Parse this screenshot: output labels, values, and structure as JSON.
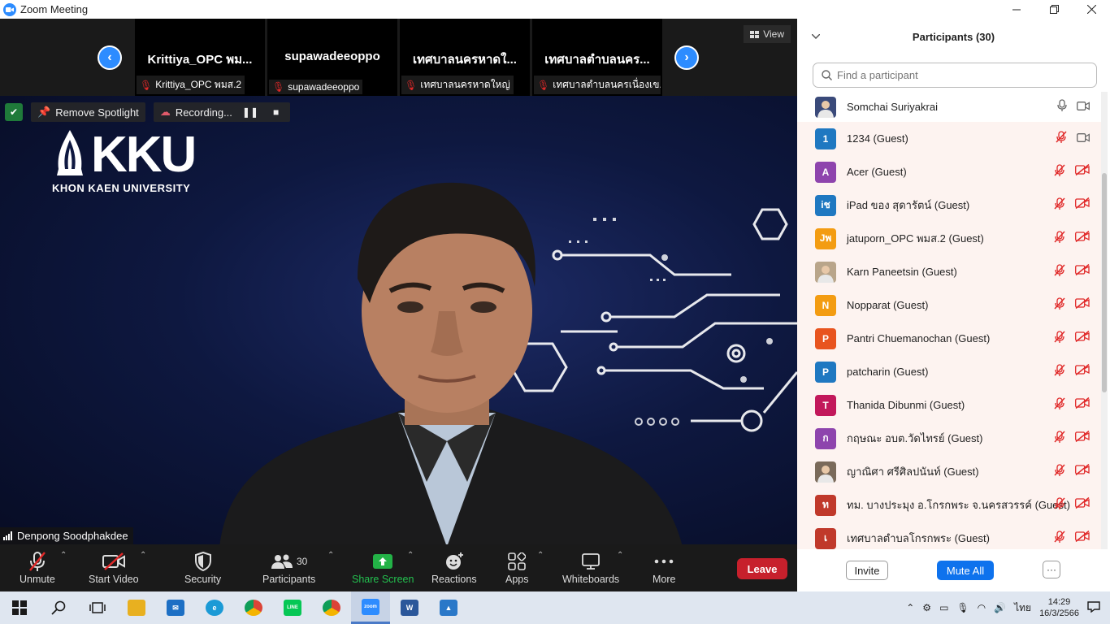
{
  "window": {
    "title": "Zoom Meeting",
    "logo_text": "zoom"
  },
  "strip": {
    "view_label": "View",
    "thumbs": [
      {
        "name": "Krittiya_OPC พม...",
        "label": "Krittiya_OPC พมส.2"
      },
      {
        "name": "supawadeeoppo",
        "label": "supawadeeoppo"
      },
      {
        "name": "เทศบาลนครหาดใ...",
        "label": "เทศบาลนครหาดใหญ่"
      },
      {
        "name": "เทศบาลตำบลนคร...",
        "label": "เทศบาลตำบลนครเนื่องเข..."
      }
    ]
  },
  "video": {
    "remove_spotlight": "Remove Spotlight",
    "recording": "Recording...",
    "logo_big": "KKU",
    "logo_small": "KHON KAEN UNIVERSITY",
    "speaker_name": "Denpong Soodphakdee"
  },
  "toolbar": {
    "unmute": "Unmute",
    "start_video": "Start Video",
    "security": "Security",
    "participants": "Participants",
    "participants_count": "30",
    "share_screen": "Share Screen",
    "reactions": "Reactions",
    "apps": "Apps",
    "whiteboards": "Whiteboards",
    "more": "More",
    "leave": "Leave"
  },
  "panel": {
    "title": "Participants (30)",
    "search_placeholder": "Find a participant",
    "invite": "Invite",
    "mute_all": "Mute All",
    "more": "···",
    "participants": [
      {
        "name": "Somchai Suriyakrai",
        "initial": "",
        "color": "#3a4a7a",
        "mic": "on",
        "video": "on"
      },
      {
        "name": "1234 (Guest)",
        "initial": "1",
        "color": "#1f78c1",
        "mic": "muted",
        "video": "on"
      },
      {
        "name": "Acer (Guest)",
        "initial": "A",
        "color": "#8e44ad",
        "mic": "muted",
        "video": "off"
      },
      {
        "name": "iPad ของ สุดารัตน์ (Guest)",
        "initial": "iช",
        "color": "#1f78c1",
        "mic": "muted",
        "video": "off"
      },
      {
        "name": "jatuporn_OPC พมส.2 (Guest)",
        "initial": "Jพ",
        "color": "#f39c12",
        "mic": "muted",
        "video": "off"
      },
      {
        "name": "Karn Paneetsin (Guest)",
        "initial": "",
        "color": "#b9a58a",
        "mic": "muted",
        "video": "off"
      },
      {
        "name": "Nopparat (Guest)",
        "initial": "N",
        "color": "#f39c12",
        "mic": "muted",
        "video": "off"
      },
      {
        "name": "Pantri Chuemanochan (Guest)",
        "initial": "P",
        "color": "#e8541f",
        "mic": "muted",
        "video": "off"
      },
      {
        "name": "patcharin (Guest)",
        "initial": "P",
        "color": "#1f78c1",
        "mic": "muted",
        "video": "off"
      },
      {
        "name": "Thanida Dibunmi (Guest)",
        "initial": "T",
        "color": "#c2185b",
        "mic": "muted",
        "video": "off"
      },
      {
        "name": "กฤษณะ  อบต.วัดไทรย์ (Guest)",
        "initial": "ก",
        "color": "#8e44ad",
        "mic": "muted",
        "video": "off"
      },
      {
        "name": "ญาณิศา ศรีศิลปนันท์ (Guest)",
        "initial": "",
        "color": "#7a6a5a",
        "mic": "muted",
        "video": "off"
      },
      {
        "name": "ทม. บางประมุง อ.โกรกพระ จ.นครสวรรค์ (Guest)",
        "initial": "ท",
        "color": "#c0392b",
        "mic": "muted",
        "video": "off"
      },
      {
        "name": "เทศบาลตำบลโกรกพระ (Guest)",
        "initial": "เ",
        "color": "#c0392b",
        "mic": "muted",
        "video": "off"
      }
    ]
  },
  "taskbar": {
    "lang": "ไทย",
    "time": "14:29",
    "date": "16/3/2566"
  },
  "colors": {
    "zoom_blue": "#2d8cff",
    "leave_red": "#c7202c",
    "mute_all_blue": "#0e72ed",
    "muted_red": "#e02828"
  }
}
